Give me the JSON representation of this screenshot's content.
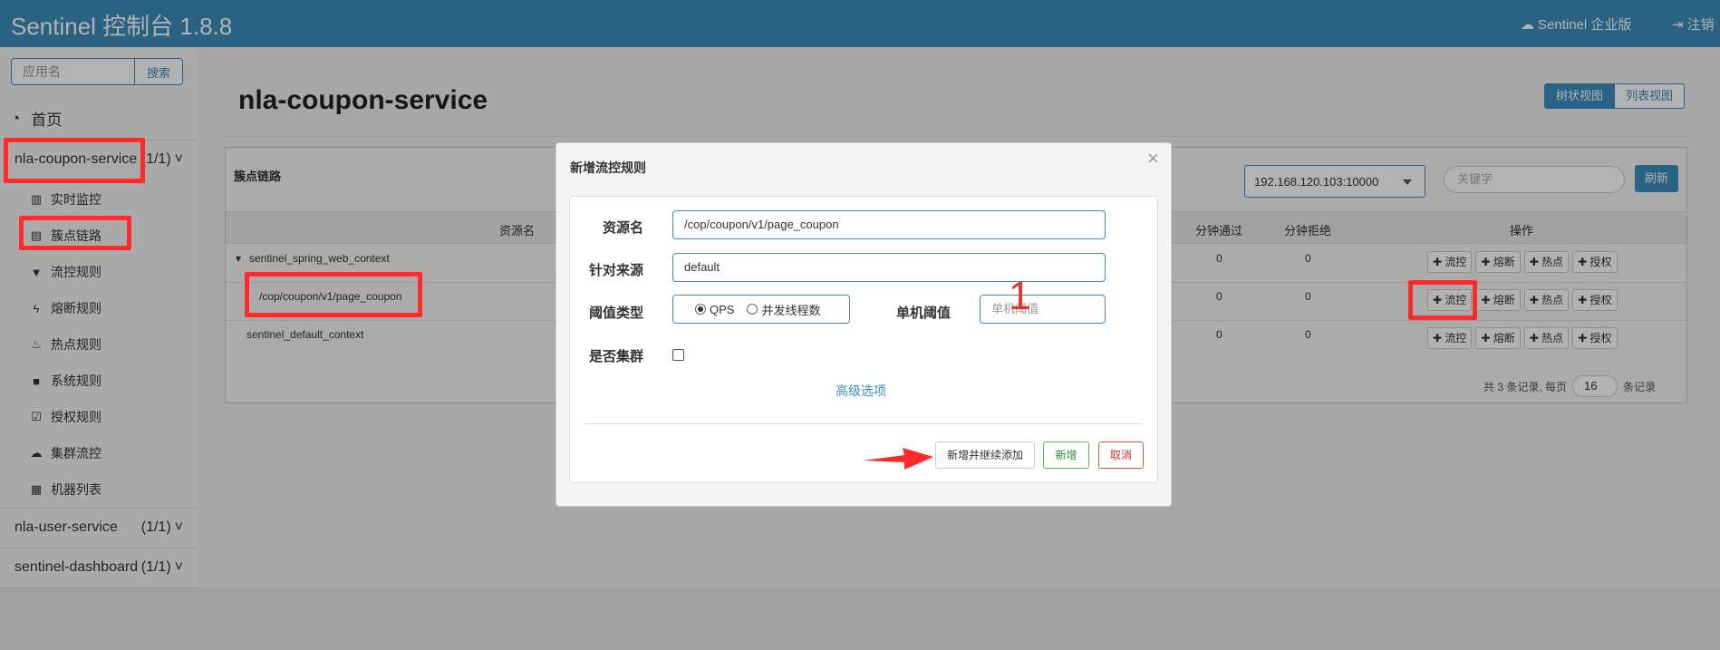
{
  "navbar": {
    "brand": "Sentinel 控制台 1.8.8",
    "enterprise": "Sentinel 企业版",
    "logout": "注销"
  },
  "sidebar": {
    "search_placeholder": "应用名",
    "search_button": "搜索",
    "home": "首页",
    "apps": [
      {
        "name": "nla-coupon-service",
        "count": "(1/1)"
      },
      {
        "name": "nla-user-service",
        "count": "(1/1)"
      },
      {
        "name": "sentinel-dashboard",
        "count": "(1/1)"
      }
    ],
    "menu": [
      {
        "label": "实时监控",
        "icon": "bar-chart-icon"
      },
      {
        "label": "簇点链路",
        "icon": "list-icon"
      },
      {
        "label": "流控规则",
        "icon": "filter-icon"
      },
      {
        "label": "熔断规则",
        "icon": "bolt-icon"
      },
      {
        "label": "热点规则",
        "icon": "fire-icon"
      },
      {
        "label": "系统规则",
        "icon": "lock-icon"
      },
      {
        "label": "授权规则",
        "icon": "check-square-icon"
      },
      {
        "label": "集群流控",
        "icon": "cloud-icon"
      },
      {
        "label": "机器列表",
        "icon": "th-list-icon"
      }
    ]
  },
  "main": {
    "title": "nla-coupon-service",
    "view_tree": "树状视图",
    "view_list": "列表视图",
    "panel_title": "簇点链路",
    "machine": "192.168.120.103:10000",
    "keyword_placeholder": "关键字",
    "refresh": "刷新",
    "columns": {
      "resource": "资源名",
      "pass_per_min": "分钟通过",
      "block_per_min": "分钟拒绝",
      "ops": "操作"
    },
    "rows": [
      {
        "name": "sentinel_spring_web_context",
        "pass": "0",
        "block": "0"
      },
      {
        "name": "/cop/coupon/v1/page_coupon",
        "pass": "0",
        "block": "0"
      },
      {
        "name": "sentinel_default_context",
        "pass": "0",
        "block": "0"
      }
    ],
    "op_buttons": [
      "✚ 流控",
      "✚ 熔断",
      "✚ 热点",
      "✚ 授权"
    ],
    "pager_text": "共 3 条记录, 每页",
    "page_size": "16",
    "pager_suffix": "条记录"
  },
  "modal": {
    "title": "新增流控规则",
    "close": "×",
    "resource_label": "资源名",
    "resource_value": "/cop/coupon/v1/page_coupon",
    "source_label": "针对来源",
    "source_value": "default",
    "threshold_type_label": "阈值类型",
    "qps": "QPS",
    "threads": "并发线程数",
    "threshold_label": "单机阈值",
    "threshold_placeholder": "单机阈值",
    "cluster_label": "是否集群",
    "advanced": "高级选项",
    "btn_add_continue": "新增并继续添加",
    "btn_add": "新增",
    "btn_cancel": "取消"
  },
  "annotation": {
    "step_number": "1",
    "highlight_color": "#ff2a2a"
  }
}
